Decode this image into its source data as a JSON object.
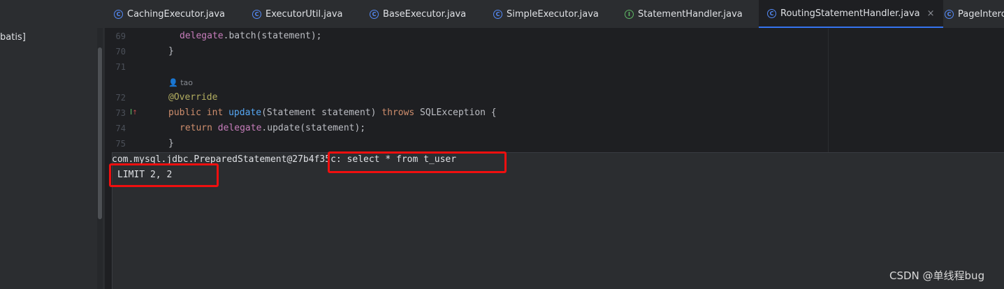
{
  "project_panel": {
    "label": "batis]"
  },
  "tabs": [
    {
      "label": "CachingExecutor.java",
      "icon": "class-icon"
    },
    {
      "label": "ExecutorUtil.java",
      "icon": "class-icon"
    },
    {
      "label": "BaseExecutor.java",
      "icon": "class-icon"
    },
    {
      "label": "SimpleExecutor.java",
      "icon": "class-icon"
    },
    {
      "label": "StatementHandler.java",
      "icon": "interface-icon"
    },
    {
      "label": "RoutingStatementHandler.java",
      "icon": "class-icon",
      "active": true
    },
    {
      "label": "PageInterc",
      "icon": "class-icon"
    }
  ],
  "icon_glyphs": {
    "class": "C",
    "interface": "I",
    "close": "×"
  },
  "editor": {
    "line_numbers": [
      "69",
      "70",
      "71",
      "72",
      "73",
      "74",
      "75"
    ],
    "author_hint": "tao",
    "lines": {
      "l69": {
        "field": "delegate",
        "rest": ".batch(statement);"
      },
      "l70": "}",
      "l72": "@Override",
      "l73": {
        "kw1": "public",
        "kw2": "int",
        "method": "update",
        "params": "(Statement statement) ",
        "kw3": "throws",
        "rest": " SQLException {"
      },
      "l74": {
        "kw": "return",
        "field": "delegate",
        "rest": ".update(statement);"
      },
      "l75": "}"
    }
  },
  "console": {
    "line1": "com.mysql.jdbc.PreparedStatement@27b4f35c: select * from t_user",
    "line2": "LIMIT 2, 2"
  },
  "watermark": "CSDN @单线程bug",
  "colors": {
    "highlight_box": "#f00f0f",
    "active_tab_underline": "#3574f0"
  }
}
